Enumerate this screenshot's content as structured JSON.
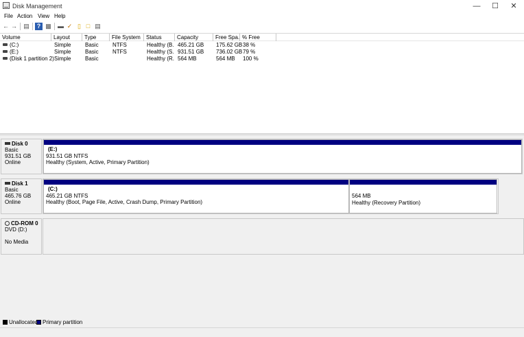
{
  "window": {
    "title": "Disk Management"
  },
  "menu": {
    "file": "File",
    "action": "Action",
    "view": "View",
    "help": "Help"
  },
  "toolbar": [
    "back-icon",
    "forward-icon",
    "list-icon",
    "help-icon",
    "properties-icon",
    "disk-icon",
    "check-icon",
    "folder-icon",
    "details-icon"
  ],
  "volumes": {
    "columns": [
      "Volume",
      "Layout",
      "Type",
      "File System",
      "Status",
      "Capacity",
      "Free Spa...",
      "% Free"
    ],
    "rows": [
      [
        "(C:)",
        "Simple",
        "Basic",
        "NTFS",
        "Healthy (B...",
        "465.21 GB",
        "175.62 GB",
        "38 %"
      ],
      [
        "(E:)",
        "Simple",
        "Basic",
        "NTFS",
        "Healthy (S...",
        "931.51 GB",
        "736.02 GB",
        "79 %"
      ],
      [
        "(Disk 1 partition 2)",
        "Simple",
        "Basic",
        "",
        "Healthy (R...",
        "564 MB",
        "564 MB",
        "100 %"
      ]
    ]
  },
  "disks": {
    "disk0": {
      "name": "Disk 0",
      "type": "Basic",
      "size": "931.51 GB",
      "status": "Online",
      "partition": {
        "name": "(E:)",
        "size": "931.51 GB NTFS",
        "status": "Healthy (System, Active, Primary Partition)"
      }
    },
    "disk1": {
      "name": "Disk 1",
      "type": "Basic",
      "size": "465.76 GB",
      "status": "Online",
      "partition1": {
        "name": "(C:)",
        "size": "465.21 GB NTFS",
        "status": "Healthy (Boot, Page File, Active, Crash Dump, Primary Partition)"
      },
      "partition2": {
        "size": "564 MB",
        "status": "Healthy (Recovery Partition)"
      }
    },
    "cdrom0": {
      "name": "CD-ROM 0",
      "drive": "DVD (D:)",
      "media": "No Media"
    }
  },
  "legend": {
    "unallocated": "Unallocated",
    "primary": "Primary partition",
    "unallocated_color": "#000000",
    "primary_color": "#000080"
  }
}
